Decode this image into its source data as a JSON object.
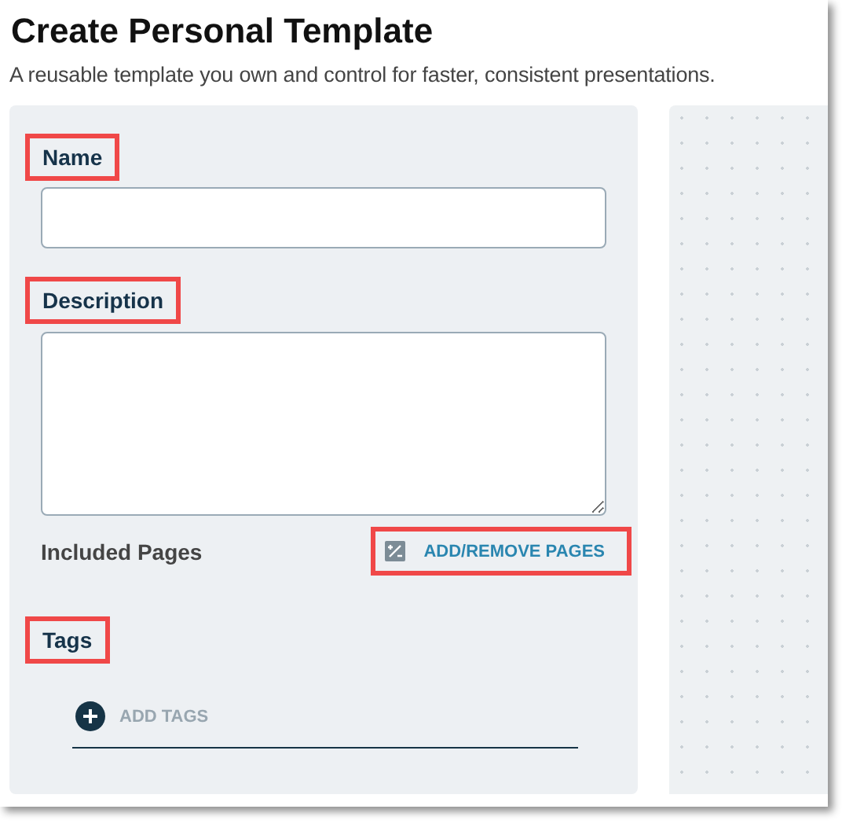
{
  "title": "Create Personal Template",
  "subtitle": "A reusable template you own and control for faster, consistent presentations.",
  "name_field": {
    "label": "Name",
    "highlighted": true
  },
  "description_field": {
    "label": "Description",
    "highlighted": true
  },
  "included_pages": {
    "label": "Included Pages",
    "button": "ADD/REMOVE PAGES",
    "highlighted": true
  },
  "tags": {
    "label": "Tags",
    "highlighted": true,
    "button": "ADD TAGS"
  }
}
